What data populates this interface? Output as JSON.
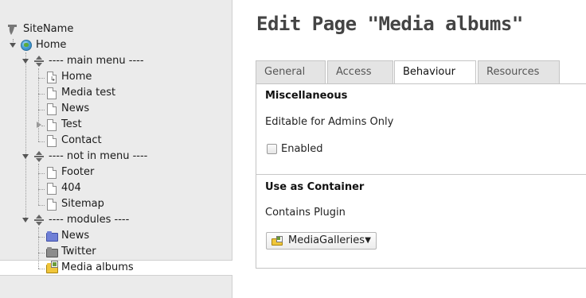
{
  "tree": {
    "root_label": "SiteName",
    "home_label": "Home",
    "items": [
      {
        "label": "---- main menu ----"
      },
      {
        "label": "Home"
      },
      {
        "label": "Media test"
      },
      {
        "label": "News"
      },
      {
        "label": "Test"
      },
      {
        "label": "Contact"
      },
      {
        "label": "---- not in menu ----"
      },
      {
        "label": "Footer"
      },
      {
        "label": "404"
      },
      {
        "label": "Sitemap"
      },
      {
        "label": "---- modules ----"
      },
      {
        "label": "News"
      },
      {
        "label": "Twitter"
      },
      {
        "label": "Media albums"
      }
    ],
    "selected": "Media albums"
  },
  "main": {
    "title": "Edit Page \"Media albums\"",
    "tabs": [
      {
        "label": "General"
      },
      {
        "label": "Access"
      },
      {
        "label": "Behaviour",
        "active": true
      },
      {
        "label": "Resources"
      }
    ],
    "sections": {
      "misc": {
        "title": "Miscellaneous",
        "editable_label": "Editable for Admins Only",
        "checkbox_label": "Enabled",
        "checkbox_checked": false
      },
      "container": {
        "title": "Use as Container",
        "plugin_label": "Contains Plugin",
        "plugin_value": "MediaGalleries"
      }
    }
  },
  "colors": {
    "tree_bg": "#ebebeb",
    "folder_news": "#6f7fd6",
    "folder_twitter": "#8c8c8c",
    "folder_media": "#f0c63a"
  }
}
